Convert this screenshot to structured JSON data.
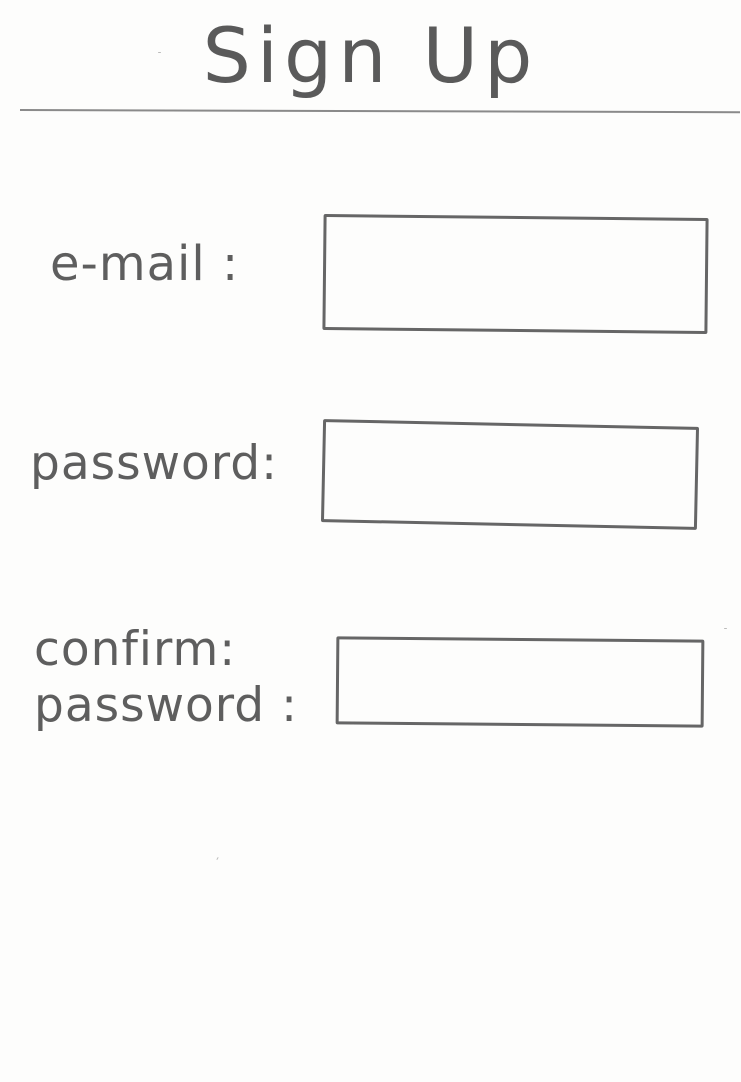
{
  "header": {
    "title": "Sign Up"
  },
  "form": {
    "email": {
      "label": "e-mail :",
      "value": "",
      "placeholder": ""
    },
    "password": {
      "label": "password:",
      "value": "",
      "placeholder": ""
    },
    "confirm_password": {
      "label_line1": "confirm:",
      "label_line2": "password :",
      "value": "",
      "placeholder": ""
    }
  }
}
